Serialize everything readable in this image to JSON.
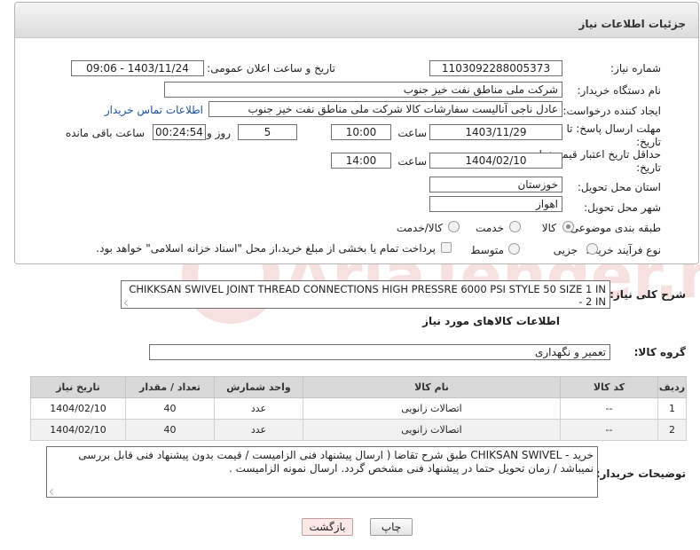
{
  "header": {
    "title": "جزئیات اطلاعات نیاز"
  },
  "form": {
    "need_number_label": "شماره نیاز:",
    "need_number": "1103092288005373",
    "announce_label": "تاریخ و ساعت اعلان عمومی:",
    "announce_value": "1403/11/24 - 09:06",
    "buyer_org_label": "نام دستگاه خریدار:",
    "buyer_org": "شرکت ملی مناطق نفت خیز جنوب",
    "creator_label": "ایجاد کننده درخواست:",
    "creator": "عادل  ناجی آنالیست سفارشات کالا  شرکت ملی مناطق نفت خیز جنوب",
    "contact_link": "اطلاعات تماس خریدار",
    "deadline_label_1": "مهلت ارسال پاسخ: تا",
    "deadline_label_2": "تاریخ:",
    "deadline_date": "1403/11/29",
    "time_label": "ساعت",
    "deadline_time": "10:00",
    "days_value": "5",
    "days_label": "روز و",
    "remaining_time": "00:24:54",
    "remaining_label": "ساعت باقی مانده",
    "validity_label_1": "حداقل تاریخ اعتبار قیمت: تا",
    "validity_label_2": "تاریخ:",
    "validity_date": "1404/02/10",
    "validity_time_label": "ساعت",
    "validity_time": "14:00",
    "province_label": "استان محل تحویل:",
    "province": "خوزستان",
    "city_label": "شهر محل تحویل:",
    "city": "اهواز",
    "category_label": "طبقه بندی موضوعی:",
    "category_options": [
      "کالا",
      "خدمت",
      "کالا/خدمت"
    ],
    "category_selected": "کالا",
    "process_label": "نوع فرآیند خرید :",
    "process_options": [
      "جزیی",
      "متوسط"
    ],
    "payment_note": "پرداخت تمام یا بخشی از مبلغ خرید،از محل \"اسناد خزانه اسلامی\" خواهد بود."
  },
  "summary": {
    "label": "شرح کلی نیاز:",
    "text": "CHIKKSAN SWIVEL JOINT THREAD CONNECTIONS HIGH PRESSRE 6000 PSI  STYLE 50  SIZE 1 IN - 2 IN"
  },
  "goods": {
    "section_title": "اطلاعات کالاهای مورد نیاز",
    "group_label": "گروه کالا:",
    "group_value": "تعمیر و نگهداری",
    "columns": [
      "ردیف",
      "کد کالا",
      "نام کالا",
      "واحد شمارش",
      "تعداد / مقدار",
      "تاریخ نیاز"
    ],
    "rows": [
      {
        "row": "1",
        "code": "--",
        "name": "اتصالات زانویی",
        "unit": "عدد",
        "qty": "40",
        "date": "1404/02/10"
      },
      {
        "row": "2",
        "code": "--",
        "name": "اتصالات زانویی",
        "unit": "عدد",
        "qty": "40",
        "date": "1404/02/10"
      }
    ]
  },
  "buyer_notes": {
    "label": "توضیحات خریدار:",
    "line1": "خرید  - CHIKSAN SWIVEL طبق شرح تقاضا ( ارسال پیشنهاد فنی الزامیست / قیمت بدون پیشنهاد فنی قابل بررسی",
    "line2": "نمیباشد / زمان تحویل حتما در پیشنهاد فنی مشخص گردد. ارسال نمونه الزامیست ."
  },
  "buttons": {
    "print": "چاپ",
    "back": "بازگشت"
  },
  "watermark": {
    "text": "AriaTender.neT"
  },
  "colors": {
    "link": "#1a4fa3",
    "header_bg": "#dcdcdc",
    "back_button_bg": "#fde8e8"
  }
}
